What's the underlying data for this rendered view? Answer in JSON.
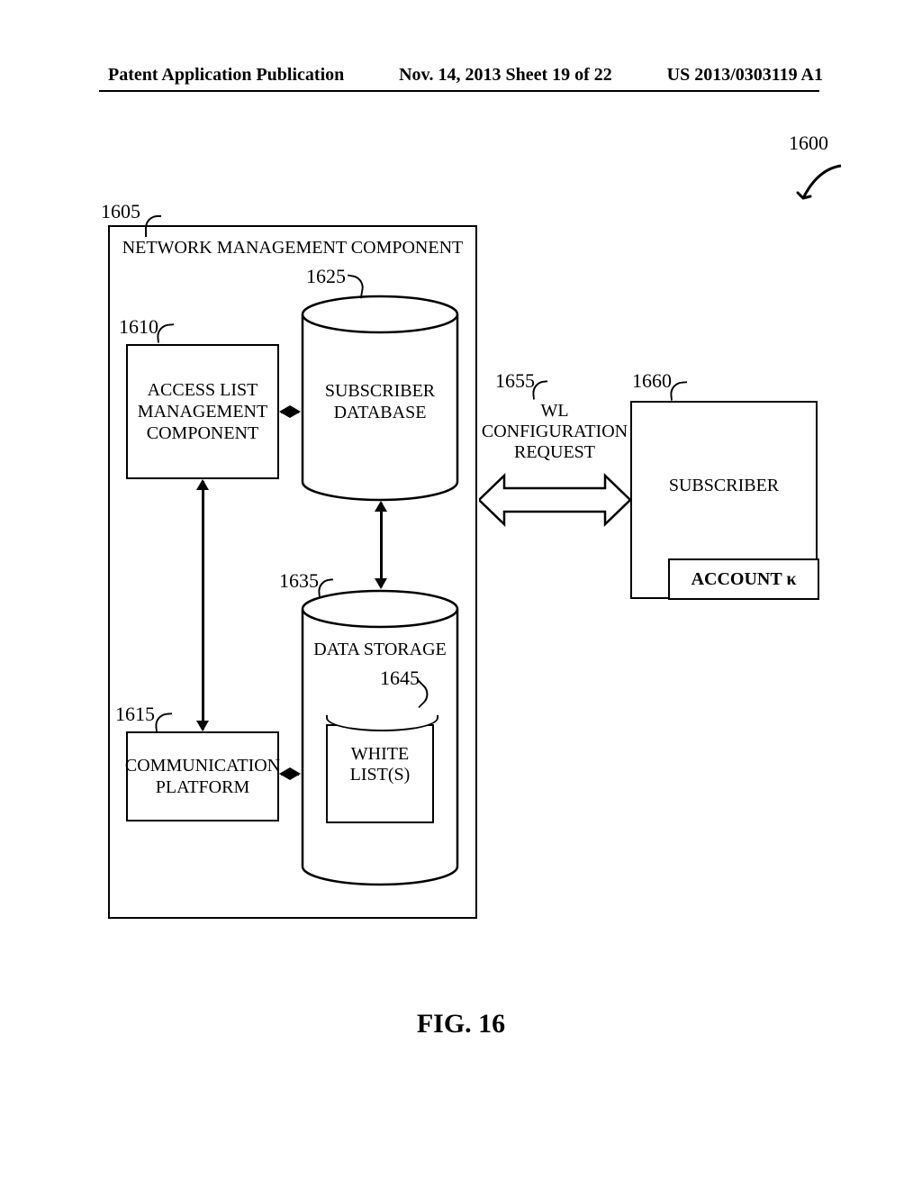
{
  "header": {
    "left": "Patent Application Publication",
    "center": "Nov. 14, 2013  Sheet 19 of 22",
    "right": "US 2013/0303119 A1"
  },
  "caption": "FIG. 16",
  "refs": {
    "overall": "1600",
    "nmc": "1605",
    "alm": "1610",
    "comm": "1615",
    "subscriber_db": "1625",
    "data_storage": "1635",
    "white_list": "1645",
    "wl_request": "1655",
    "subscriber": "1660"
  },
  "labels": {
    "nmc": "NETWORK MANAGEMENT COMPONENT",
    "alm": "ACCESS LIST MANAGEMENT COMPONENT",
    "comm": "COMMUNICATION PLATFORM",
    "subscriber_db": "SUBSCRIBER DATABASE",
    "data_storage": "DATA STORAGE",
    "white_list": "WHITE LIST(S)",
    "wl_request_l1": "WL CONFIGURATION",
    "wl_request_l2": "REQUEST",
    "subscriber": "SUBSCRIBER",
    "account": "ACCOUNT κ"
  }
}
